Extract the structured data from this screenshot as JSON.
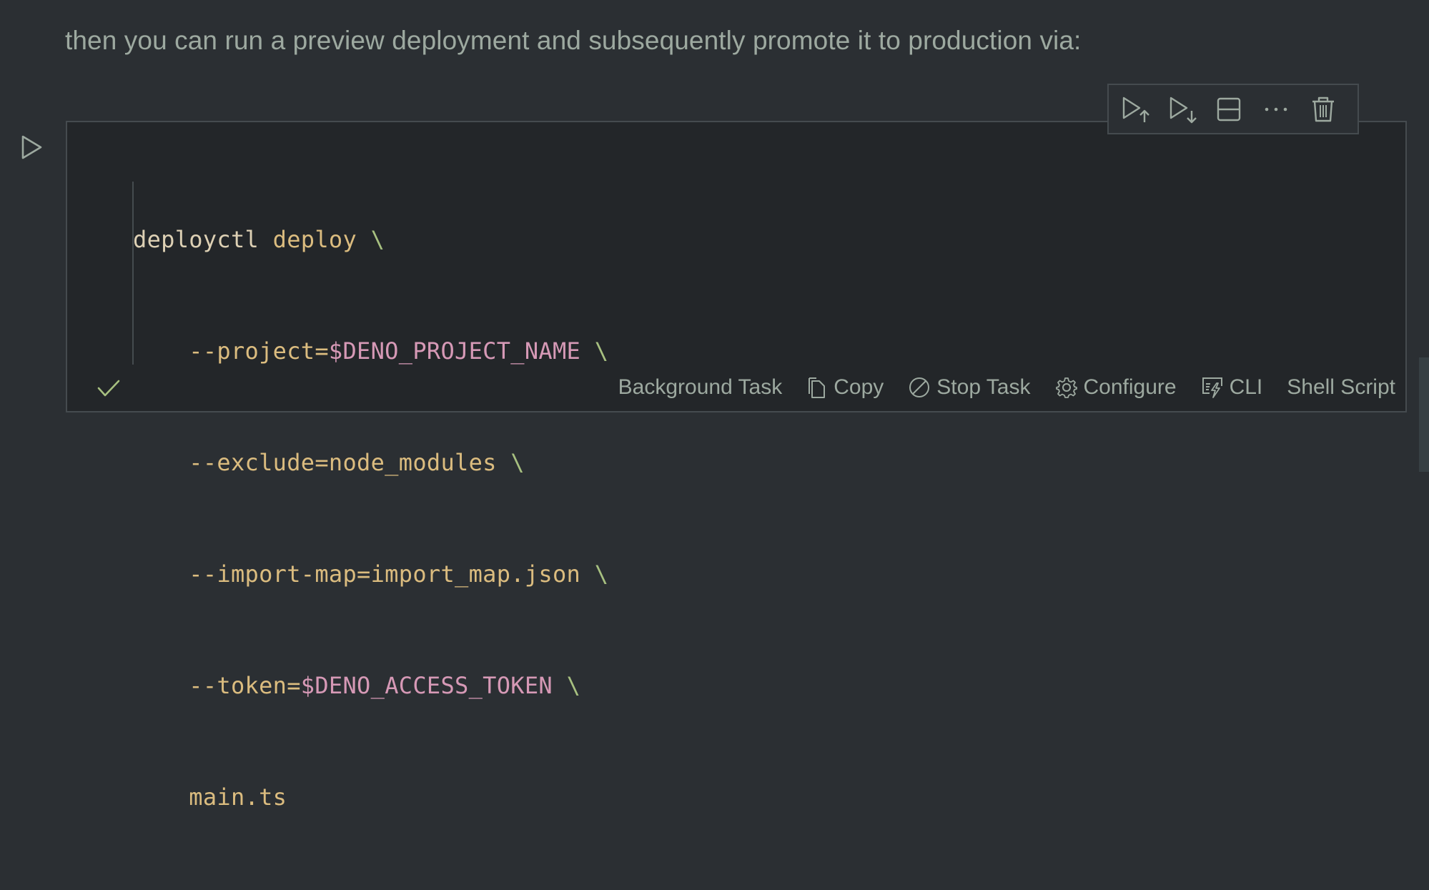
{
  "paragraph": "then you can run a preview deployment and subsequently promote it to production via:",
  "cell": {
    "run_icon": "play-icon",
    "toolbar": [
      {
        "name": "execute-above-button",
        "icon": "play-arrow-up-icon"
      },
      {
        "name": "execute-below-button",
        "icon": "play-arrow-down-icon"
      },
      {
        "name": "split-cell-button",
        "icon": "split-icon"
      },
      {
        "name": "more-actions-button",
        "icon": "ellipsis-icon"
      },
      {
        "name": "delete-cell-button",
        "icon": "trash-icon"
      }
    ],
    "code": {
      "line1": {
        "cmd": "deployctl",
        "sub": "deploy",
        "esc": "\\"
      },
      "line2": {
        "flag": "--project=",
        "var": "$DENO_PROJECT_NAME",
        "esc": "\\"
      },
      "line3": {
        "flag": "--exclude=node_modules",
        "esc": "\\"
      },
      "line4": {
        "flag": "--import-map=import_map.json",
        "esc": "\\"
      },
      "line5": {
        "flag": "--token=",
        "var": "$DENO_ACCESS_TOKEN",
        "esc": "\\"
      },
      "line6": {
        "file": "main.ts"
      }
    },
    "status": {
      "status_icon": "check-icon",
      "actions": {
        "background_task": "Background Task",
        "copy": "Copy",
        "stop_task": "Stop Task",
        "configure": "Configure",
        "cli": "CLI",
        "shell_script": "Shell Script"
      }
    }
  },
  "colors": {
    "background": "#2b2f33",
    "cell_background": "#232629",
    "border": "#454b4f",
    "text": "#9da9a0",
    "command": "#ddd0b4",
    "argument": "#dbbc7f",
    "variable": "#d699b6",
    "escape": "#a7c080"
  }
}
